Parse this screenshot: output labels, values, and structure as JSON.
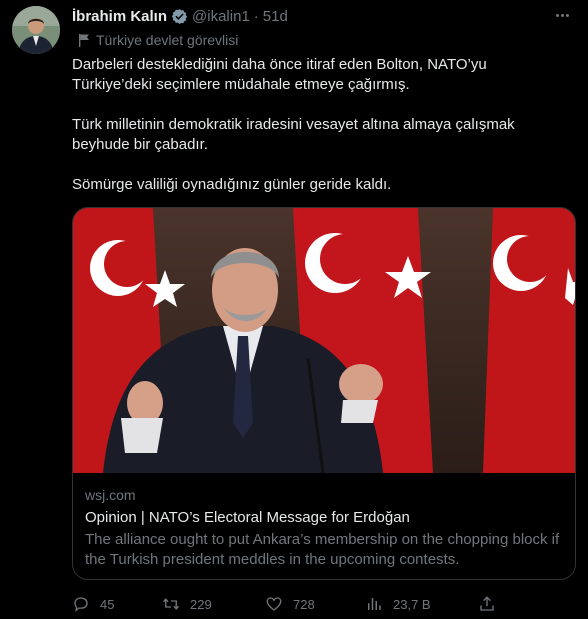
{
  "author": {
    "name": "İbrahim Kalın",
    "handle": "@ikalin1",
    "separator": "·",
    "date": "51d",
    "label": "Türkiye devlet görevlisi"
  },
  "tweet": {
    "paragraphs": [
      "Darbeleri desteklediğini daha önce itiraf eden Bolton, NATO’yu Türkiye’deki seçimlere müdahale etmeye çağırmış.",
      "Türk milletinin demokratik iradesini vesayet altına almaya çalışmak beyhude bir çabadır.",
      "Sömürge valiliği oynadığınız günler geride kaldı."
    ]
  },
  "card": {
    "domain": "wsj.com",
    "title": "Opinion | NATO’s Electoral Message for Erdoğan",
    "description": "The alliance ought to put Ankara’s membership on the chopping block if the Turkish president meddles in the upcoming contests."
  },
  "actions": {
    "replies": "45",
    "retweets": "229",
    "likes": "728",
    "views": "23,7 B"
  },
  "colors": {
    "background": "#000000",
    "text_primary": "#e7e9ea",
    "text_secondary": "#71767b",
    "border": "#2f3336",
    "verified": "#829aab"
  }
}
